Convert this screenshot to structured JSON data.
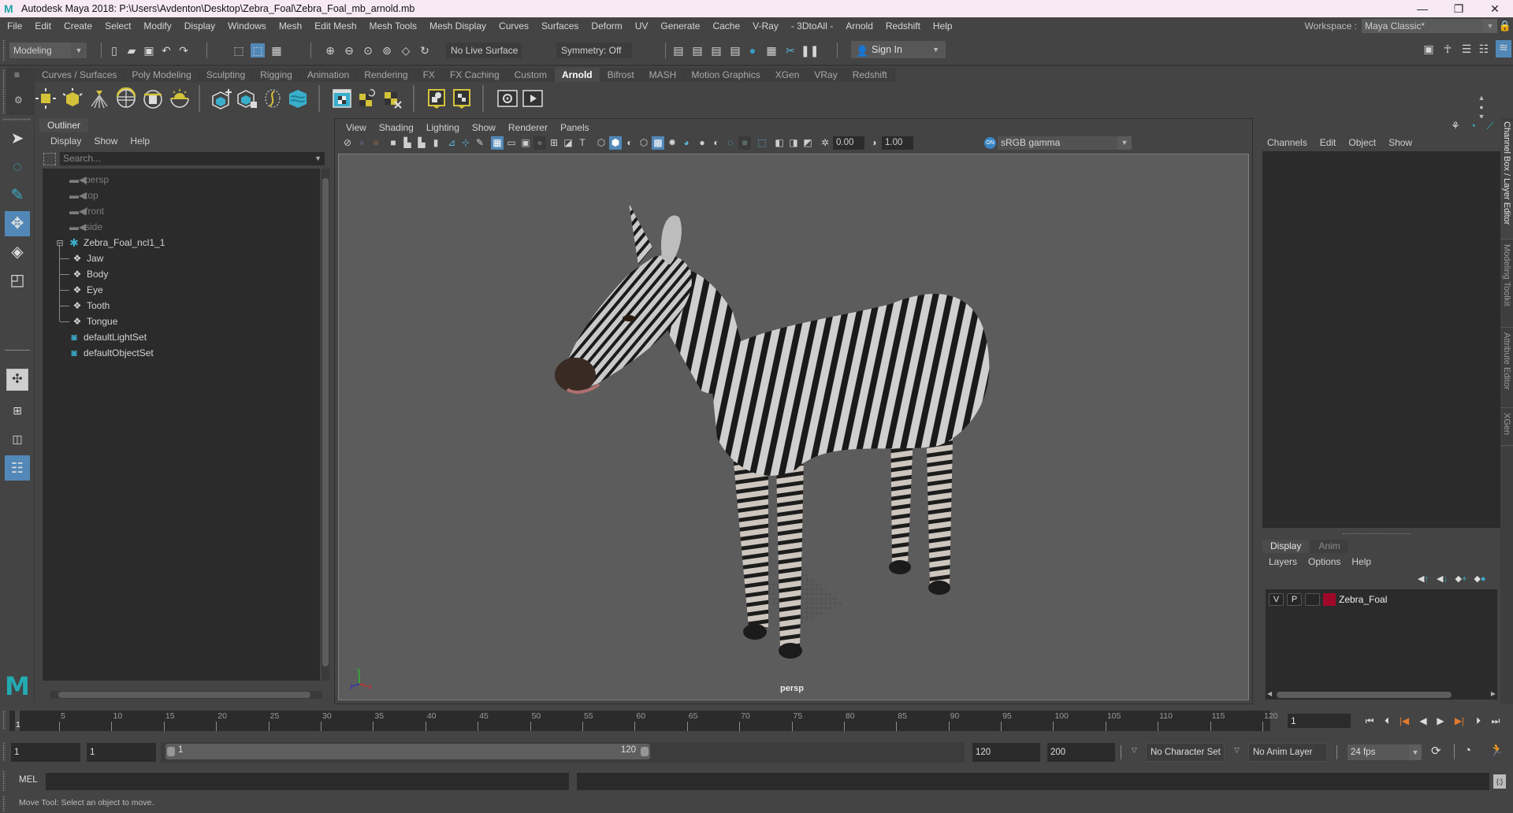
{
  "window": {
    "title": "Autodesk Maya 2018: P:\\Users\\Avdenton\\Desktop\\Zebra_Foal\\Zebra_Foal_mb_arnold.mb",
    "controls": [
      "—",
      "❐",
      "✕"
    ]
  },
  "menubar": {
    "items": [
      "File",
      "Edit",
      "Create",
      "Select",
      "Modify",
      "Display",
      "Windows",
      "Mesh",
      "Edit Mesh",
      "Mesh Tools",
      "Mesh Display",
      "Curves",
      "Surfaces",
      "Deform",
      "UV",
      "Generate",
      "Cache",
      "V-Ray",
      "- 3DtoAll -",
      "Arnold",
      "Redshift",
      "Help"
    ],
    "workspace_label": "Workspace :",
    "workspace_value": "Maya Classic*"
  },
  "statusline": {
    "mode": "Modeling",
    "live_surface": "No Live Surface",
    "symmetry": "Symmetry: Off",
    "sign_in": "Sign In"
  },
  "shelf": {
    "tabs": [
      "Curves / Surfaces",
      "Poly Modeling",
      "Sculpting",
      "Rigging",
      "Animation",
      "Rendering",
      "FX",
      "FX Caching",
      "Custom",
      "Arnold",
      "Bifrost",
      "MASH",
      "Motion Graphics",
      "XGen",
      "VRay",
      "Redshift"
    ],
    "active_tab": "Arnold",
    "icons": [
      "area-light",
      "mesh-light",
      "photometric-light",
      "skydome-light",
      "light-portal",
      "physical-sky",
      "standin-create",
      "standin-export",
      "curve-collector",
      "volume",
      "render-view",
      "tx-manager",
      "flush-textures",
      "material-view",
      "texture-view",
      "render-ipr",
      "render"
    ]
  },
  "outliner": {
    "tab": "Outliner",
    "menu": [
      "Display",
      "Show",
      "Help"
    ],
    "search_placeholder": "Search...",
    "items": [
      {
        "label": "persp",
        "type": "camera",
        "dim": true,
        "depth": 0
      },
      {
        "label": "top",
        "type": "camera",
        "dim": true,
        "depth": 0
      },
      {
        "label": "front",
        "type": "camera",
        "dim": true,
        "depth": 0
      },
      {
        "label": "side",
        "type": "camera",
        "dim": true,
        "depth": 0
      },
      {
        "label": "Zebra_Foal_ncl1_1",
        "type": "group",
        "dim": false,
        "depth": 0,
        "expanded": true
      },
      {
        "label": "Jaw",
        "type": "mesh",
        "dim": false,
        "depth": 1
      },
      {
        "label": "Body",
        "type": "mesh",
        "dim": false,
        "depth": 1
      },
      {
        "label": "Eye",
        "type": "mesh",
        "dim": false,
        "depth": 1
      },
      {
        "label": "Tooth",
        "type": "mesh",
        "dim": false,
        "depth": 1
      },
      {
        "label": "Tongue",
        "type": "mesh",
        "dim": false,
        "depth": 1
      },
      {
        "label": "defaultLightSet",
        "type": "set",
        "dim": false,
        "depth": 0
      },
      {
        "label": "defaultObjectSet",
        "type": "set",
        "dim": false,
        "depth": 0
      }
    ]
  },
  "viewport": {
    "menu": [
      "View",
      "Shading",
      "Lighting",
      "Show",
      "Renderer",
      "Panels"
    ],
    "exposure": "0.00",
    "gamma": "1.00",
    "color_space": "sRGB gamma",
    "camera_label": "persp",
    "axis": {
      "x": "x",
      "y": "y",
      "z": "z"
    }
  },
  "channelbox": {
    "menu": [
      "Channels",
      "Edit",
      "Object",
      "Show"
    ],
    "side_tabs": [
      "Channel Box / Layer Editor",
      "Modeling Toolkit",
      "Attribute Editor",
      "XGen"
    ]
  },
  "layer_editor": {
    "tabs": [
      "Display",
      "Anim"
    ],
    "active_tab": "Display",
    "menu": [
      "Layers",
      "Options",
      "Help"
    ],
    "layers": [
      {
        "visible": "V",
        "playback": "P",
        "name": "Zebra_Foal",
        "color": "#a0082a"
      }
    ]
  },
  "timeline": {
    "start": 1,
    "end": 120,
    "tick_labels": [
      5,
      10,
      15,
      20,
      25,
      30,
      35,
      40,
      45,
      50,
      55,
      60,
      65,
      70,
      75,
      80,
      85,
      90,
      95,
      100,
      105,
      110,
      115,
      120
    ],
    "current_frame": "1",
    "current_frame_field": "1"
  },
  "range": {
    "anim_start": "1",
    "playback_start": "1",
    "slider_start": "1",
    "slider_end": "120",
    "playback_end": "120",
    "anim_end": "200",
    "character_set": "No Character Set",
    "anim_layer": "No Anim Layer",
    "fps": "24 fps"
  },
  "commandline": {
    "language": "MEL"
  },
  "helpline": {
    "text": "Move Tool: Select an object to move."
  },
  "colors": {
    "accent": "#5288b8",
    "maya_teal": "#22aab0",
    "arnold_yellow": "#d4c23a",
    "playhead_orange": "#e07a2e"
  }
}
